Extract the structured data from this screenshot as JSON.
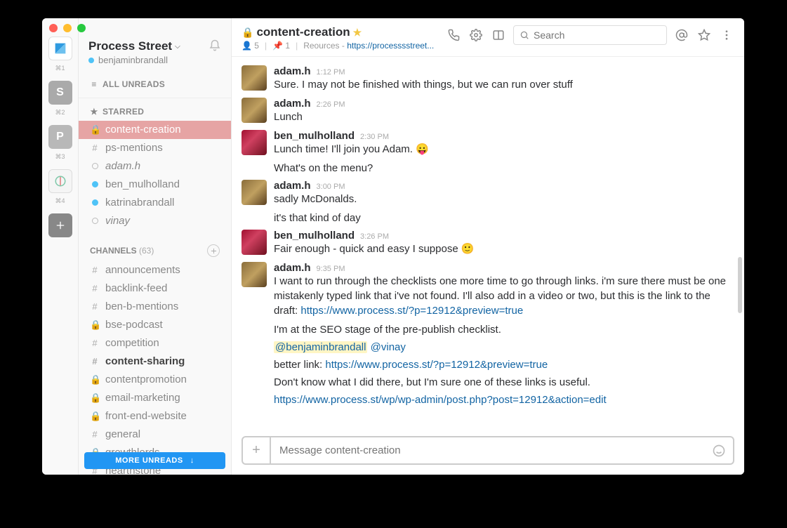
{
  "teams": [
    {
      "label": "",
      "kbd": "⌘1"
    },
    {
      "label": "S",
      "kbd": "⌘2"
    },
    {
      "label": "P",
      "kbd": "⌘3"
    },
    {
      "label": "",
      "kbd": "⌘4"
    }
  ],
  "workspace": {
    "name": "Process Street",
    "user": "benjaminbrandall"
  },
  "sections": {
    "all_unreads": "ALL UNREADS",
    "starred": "STARRED"
  },
  "starred": [
    {
      "icon": "lock",
      "label": "content-creation",
      "selected": true
    },
    {
      "icon": "hash",
      "label": "ps-mentions"
    },
    {
      "icon": "away",
      "label": "adam.h",
      "italic": true
    },
    {
      "icon": "active",
      "label": "ben_mulholland"
    },
    {
      "icon": "active",
      "label": "katrinabrandall"
    },
    {
      "icon": "away",
      "label": "vinay",
      "italic": true
    }
  ],
  "channels_header": {
    "label": "CHANNELS",
    "count": "(63)"
  },
  "channels": [
    {
      "icon": "hash",
      "label": "announcements"
    },
    {
      "icon": "hash",
      "label": "backlink-feed"
    },
    {
      "icon": "hash",
      "label": "ben-b-mentions"
    },
    {
      "icon": "lock",
      "label": "bse-podcast"
    },
    {
      "icon": "hash",
      "label": "competition"
    },
    {
      "icon": "hash",
      "label": "content-sharing",
      "bold": true
    },
    {
      "icon": "lock",
      "label": "contentpromotion"
    },
    {
      "icon": "lock",
      "label": "email-marketing"
    },
    {
      "icon": "lock",
      "label": "front-end-website"
    },
    {
      "icon": "hash",
      "label": "general"
    },
    {
      "icon": "lock",
      "label": "growthlords"
    },
    {
      "icon": "hash",
      "label": "hearthstone"
    }
  ],
  "more_unreads": "MORE UNREADS",
  "channel_header": {
    "name": "content-creation",
    "members": "5",
    "pins": "1",
    "topic_label": "Reources - ",
    "topic_link": "https://processsstreet..."
  },
  "search": {
    "placeholder": "Search"
  },
  "messages": [
    {
      "type": "msg",
      "avatar": "a",
      "user": "adam.h",
      "time": "1:12 PM",
      "text": "Sure. I may not be finished with things, but we can run over stuff"
    },
    {
      "type": "msg",
      "avatar": "a",
      "user": "adam.h",
      "time": "2:26 PM",
      "text": "Lunch"
    },
    {
      "type": "msg",
      "avatar": "b",
      "user": "ben_mulholland",
      "time": "2:30 PM",
      "text": "Lunch time! I'll join you Adam. 😛"
    },
    {
      "type": "cont",
      "text": "What's on the menu?"
    },
    {
      "type": "msg",
      "avatar": "a",
      "user": "adam.h",
      "time": "3:00 PM",
      "text": "sadly McDonalds."
    },
    {
      "type": "cont",
      "text": "it's that kind of day"
    },
    {
      "type": "msg",
      "avatar": "b",
      "user": "ben_mulholland",
      "time": "3:26 PM",
      "text": "Fair enough - quick and easy I suppose 🙂"
    },
    {
      "type": "msg",
      "avatar": "a",
      "user": "adam.h",
      "time": "9:35 PM",
      "text": "I want to run through the checklists one more time to go through links. i'm sure there must be one mistakenly typed link that i've not found. I'll also add in a video or two, but this is the link to the draft: ",
      "link": "https://www.process.st/?p=12912&preview=true"
    },
    {
      "type": "cont",
      "text": "I'm at the SEO stage of the pre-publish checklist."
    },
    {
      "type": "cont-mentions",
      "m1": "@benjaminbrandall",
      "m2": "@vinay"
    },
    {
      "type": "cont-link",
      "pre": "better link: ",
      "link": "https://www.process.st/?p=12912&preview=true"
    },
    {
      "type": "cont",
      "text": "Don't know what I did there, but I'm sure one of these links is useful."
    },
    {
      "type": "cont-linkonly",
      "link": "https://www.process.st/wp/wp-admin/post.php?post=12912&action=edit"
    }
  ],
  "composer": {
    "placeholder": "Message content-creation"
  }
}
